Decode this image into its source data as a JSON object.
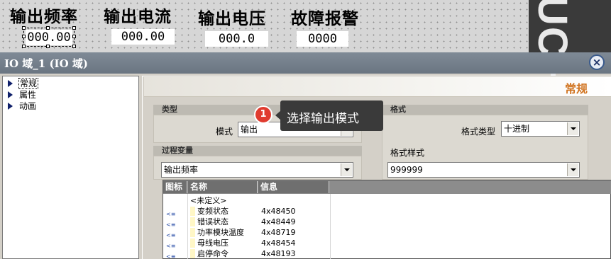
{
  "canvas": {
    "labels": [
      "输出频率",
      "输出电流",
      "输出电压",
      "故障报警"
    ],
    "fields": [
      "000.00",
      "000.00",
      "000.0",
      "0000"
    ],
    "logo_text": "UCH"
  },
  "dialog": {
    "title": "IO 域_1 (IO 域)",
    "close_icon": "×",
    "nav": [
      "常规",
      "属性",
      "动画"
    ],
    "panel_title": "常规",
    "type_group": {
      "title": "类型",
      "mode_label": "模式",
      "mode_value": "输出"
    },
    "format_group": {
      "title": "格式",
      "format_type_label": "格式类型",
      "format_type_value": "十进制",
      "format_style_label": "格式样式",
      "format_style_value": "999999"
    },
    "process_group": {
      "title": "过程变量",
      "value": "输出频率"
    },
    "tooltip": {
      "step": "1",
      "text": "选择输出模式"
    },
    "tag_table": {
      "headers": [
        "图标",
        "名称",
        "信息"
      ],
      "rows": [
        {
          "icon": "",
          "name": "<未定义>",
          "info": ""
        },
        {
          "icon": "<≡",
          "name": "变频状态",
          "info": "4x48450"
        },
        {
          "icon": "<≡",
          "name": "错误状态",
          "info": "4x48449"
        },
        {
          "icon": "<≡",
          "name": "功率模块温度",
          "info": "4x48719"
        },
        {
          "icon": "<≡",
          "name": "母线电压",
          "info": "4x48454"
        },
        {
          "icon": "<≡",
          "name": "启停命令",
          "info": "4x48193"
        }
      ]
    }
  },
  "colors": {
    "panel_title": "#d0731f",
    "badge": "#e03b2f",
    "tooltip_bg": "#3a3a3a",
    "titlebar": "#6f7a86"
  }
}
